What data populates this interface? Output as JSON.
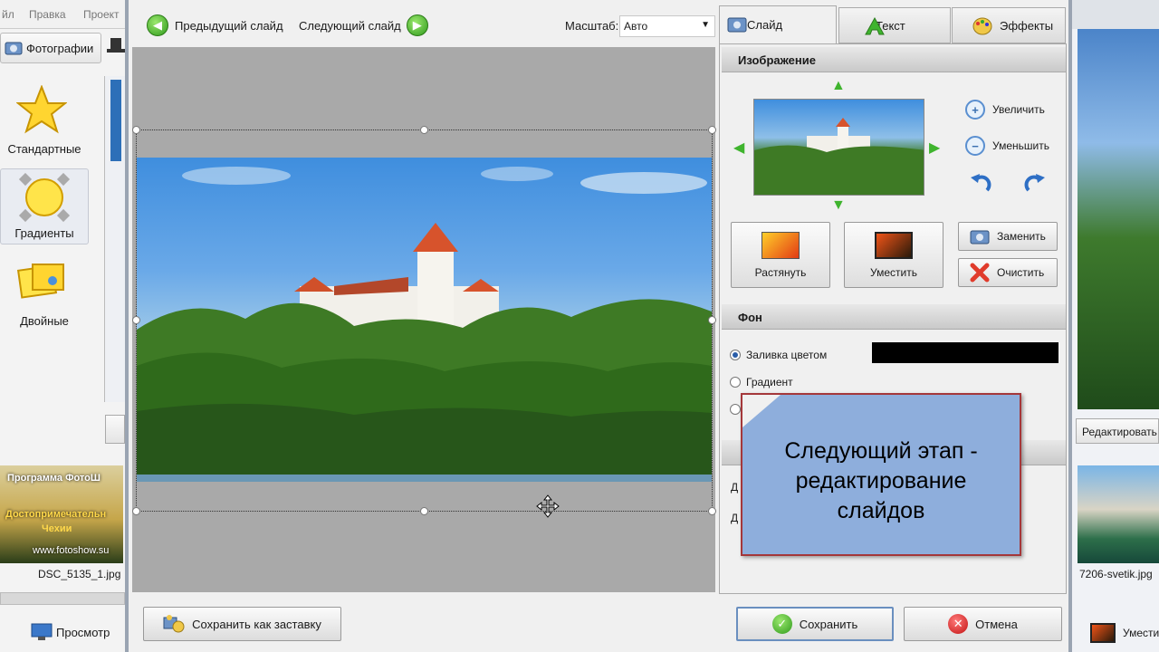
{
  "background_app": {
    "menu": [
      "йл",
      "Правка",
      "Проект"
    ],
    "tab_photos": "Фотографии",
    "styles": [
      "Стандартные",
      "Градиенты",
      "Двойные"
    ],
    "left_thumb_lines": [
      "Программа ФотоШ",
      "Достопримечательн",
      "Чехии",
      "www.fotoshow.su"
    ],
    "left_filename": "DSC_5135_1.jpg",
    "preview_button": "Просмотр",
    "right_edit_button": "Редактировать",
    "right_filename": "7206-svetik.jpg",
    "right_bottom_label": "Уместить"
  },
  "toolbar": {
    "prev_slide": "Предыдущий слайд",
    "next_slide": "Следующий слайд",
    "zoom_label": "Масштаб:",
    "zoom_value": "Авто"
  },
  "tabs": [
    {
      "label": "Слайд",
      "active": true
    },
    {
      "label": "Текст",
      "active": false
    },
    {
      "label": "Эффекты",
      "active": false
    }
  ],
  "image_section": {
    "header": "Изображение",
    "zoom_in": "Увеличить",
    "zoom_out": "Уменьшить",
    "stretch": "Растянуть",
    "fit": "Уместить",
    "replace": "Заменить",
    "clear": "Очистить"
  },
  "background_section": {
    "header": "Фон",
    "fill_color": "Заливка цветом",
    "gradient": "Градиент",
    "photo_partial": "Фо",
    "fill_color_value": "#000000",
    "partial_labels": [
      "Д",
      "Д"
    ]
  },
  "callout": {
    "lines": [
      "Следующий этап -",
      "редактирование",
      "слайдов"
    ]
  },
  "footer": {
    "save_as_screensaver": "Сохранить как заставку",
    "save": "Сохранить",
    "cancel": "Отмена"
  }
}
